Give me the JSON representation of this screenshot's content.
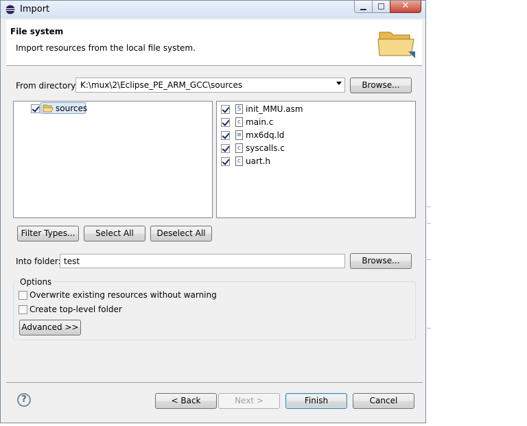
{
  "window": {
    "title": "Import",
    "icon": "eclipse-icon"
  },
  "header": {
    "title": "File system",
    "description": "Import resources from the local file system.",
    "icon": "folder-icon"
  },
  "from_directory": {
    "label": "From directory:",
    "value": "K:\\mux\\2\\Eclipse_PE_ARM_GCC\\sources",
    "browse_label": "Browse..."
  },
  "tree": {
    "items": [
      {
        "label": "sources",
        "checked": true
      }
    ]
  },
  "files": [
    {
      "name": "init_MMU.asm",
      "icon_glyph": "S",
      "checked": true
    },
    {
      "name": "main.c",
      "icon_glyph": "c",
      "checked": true
    },
    {
      "name": "mx6dq.ld",
      "icon_glyph": "≡",
      "checked": true
    },
    {
      "name": "syscalls.c",
      "icon_glyph": "c",
      "checked": true
    },
    {
      "name": "uart.h",
      "icon_glyph": "c",
      "checked": true
    }
  ],
  "selection_buttons": {
    "filter_types": "Filter Types...",
    "select_all": "Select All",
    "deselect_all": "Deselect All"
  },
  "into_folder": {
    "label": "Into folder:",
    "value": "test",
    "browse_label": "Browse..."
  },
  "options": {
    "title": "Options",
    "overwrite": {
      "label": "Overwrite existing resources without warning",
      "checked": false
    },
    "top_level": {
      "label": "Create top-level folder",
      "checked": false
    },
    "advanced_label": "Advanced >>"
  },
  "footer": {
    "help_glyph": "?",
    "back_label": "< Back",
    "next_label": "Next >",
    "finish_label": "Finish",
    "cancel_label": "Cancel"
  }
}
